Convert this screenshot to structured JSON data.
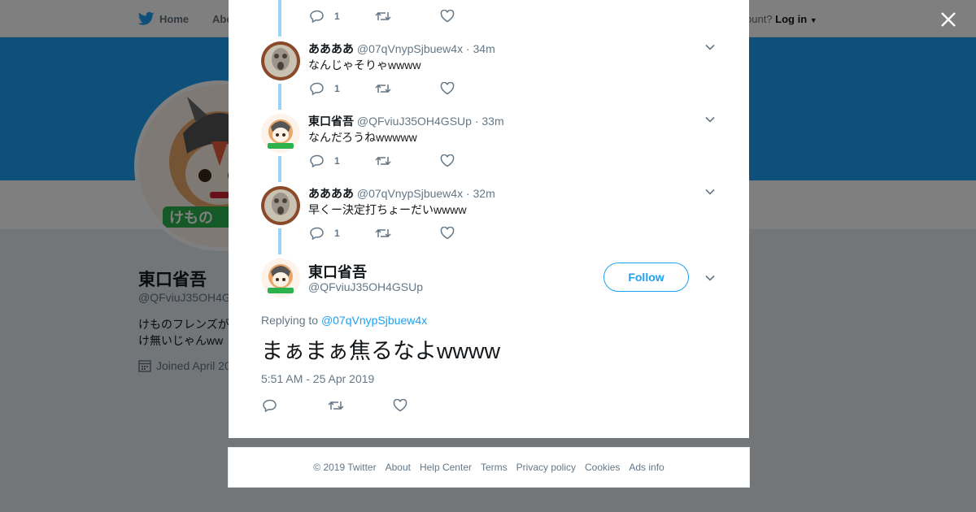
{
  "topbar": {
    "home_label": "Home",
    "about_label": "Abo",
    "login_prompt": "ccount?",
    "login_label": "Log in"
  },
  "profile": {
    "name": "東口省吾",
    "handle": "@QFviuJ35OH4G",
    "bio_line1": "けものフレンズが",
    "bio_line2": "け無いじゃんww",
    "joined": "Joined April 20"
  },
  "thread": {
    "top_reply_count": "1",
    "replies": [
      {
        "name": "ああああ",
        "handle": "@07qVnypSjbuew4x",
        "time": "· 34m",
        "text": "なんじゃそりゃwwww",
        "reply_count": "1"
      },
      {
        "name": "東口省吾",
        "handle": "@QFviuJ35OH4GSUp",
        "time": "· 33m",
        "text": "なんだろうねwwwww",
        "reply_count": "1"
      },
      {
        "name": "ああああ",
        "handle": "@07qVnypSjbuew4x",
        "time": "· 32m",
        "text": "早くー決定打ちょーだいwwww",
        "reply_count": "1"
      }
    ]
  },
  "main_tweet": {
    "name": "東口省吾",
    "handle": "@QFviuJ35OH4GSUp",
    "follow_label": "Follow",
    "replying_prefix": "Replying to",
    "replying_to": "@07qVnypSjbuew4x",
    "text": "まぁまぁ焦るなよwwww",
    "timestamp": "5:51 AM - 25 Apr 2019"
  },
  "footer": {
    "links": [
      "© 2019 Twitter",
      "About",
      "Help Center",
      "Terms",
      "Privacy policy",
      "Cookies",
      "Ads info"
    ]
  },
  "colors": {
    "accent": "#1da1f2",
    "thread_line": "#9ad4f5",
    "banner": "#1da1f2"
  },
  "icons": [
    "twitter-bird-icon",
    "reply-icon",
    "retweet-icon",
    "like-icon",
    "chevron-down-icon",
    "close-icon",
    "calendar-icon"
  ]
}
